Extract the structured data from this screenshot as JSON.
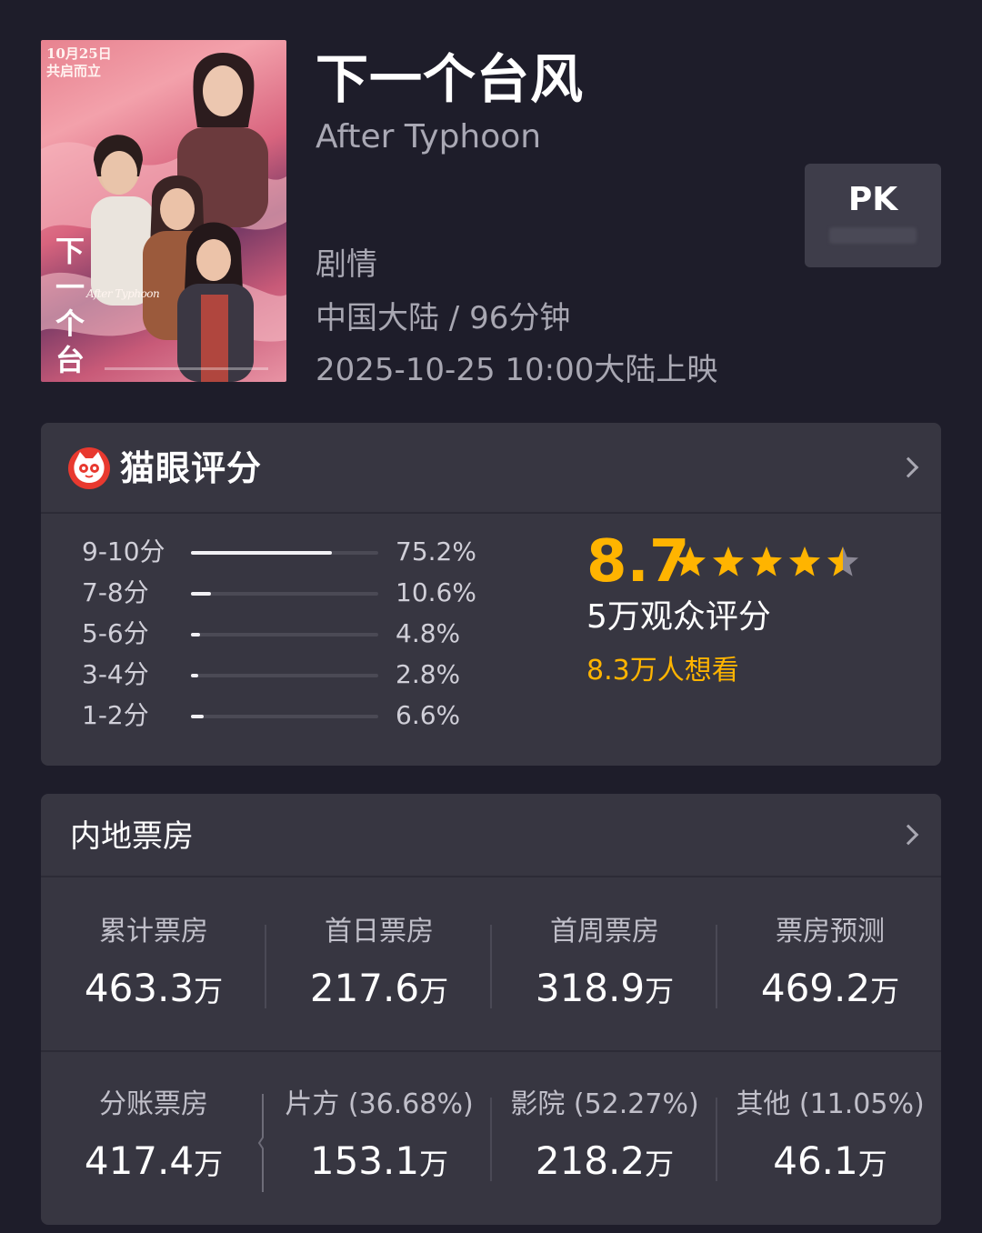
{
  "movie": {
    "title": "下一个台风",
    "title_en": "After Typhoon",
    "genre": "剧情",
    "country_duration": "中国大陆 / 96分钟",
    "release": "2025-10-25 10:00大陆上映",
    "pk_label": "PK",
    "poster": {
      "date_line1": "10月25日",
      "date_line2": "共启而立",
      "title_cn": "下一个台风",
      "title_en": "After Typhoon"
    }
  },
  "rating": {
    "brand_title": "猫眼评分",
    "score": "8.7",
    "stars": 4.5,
    "audience_count": "5万观众评分",
    "want_to_see": "8.3万人想看",
    "distribution": [
      {
        "label": "9-10分",
        "pct": "75.2%",
        "value": 75.2
      },
      {
        "label": "7-8分",
        "pct": "10.6%",
        "value": 10.6
      },
      {
        "label": "5-6分",
        "pct": "4.8%",
        "value": 4.8
      },
      {
        "label": "3-4分",
        "pct": "2.8%",
        "value": 2.8
      },
      {
        "label": "1-2分",
        "pct": "6.6%",
        "value": 6.6
      }
    ],
    "accent_color": "#ffb400"
  },
  "box_office": {
    "title": "内地票房",
    "row1": [
      {
        "label": "累计票房",
        "value": "463.3",
        "unit": "万"
      },
      {
        "label": "首日票房",
        "value": "217.6",
        "unit": "万"
      },
      {
        "label": "首周票房",
        "value": "318.9",
        "unit": "万"
      },
      {
        "label": "票房预测",
        "value": "469.2",
        "unit": "万"
      }
    ],
    "row2": [
      {
        "label": "分账票房",
        "value": "417.4",
        "unit": "万"
      },
      {
        "label": "片方 (36.68%)",
        "value": "153.1",
        "unit": "万"
      },
      {
        "label": "影院 (52.27%)",
        "value": "218.2",
        "unit": "万"
      },
      {
        "label": "其他 (11.05%)",
        "value": "46.1",
        "unit": "万"
      }
    ]
  }
}
